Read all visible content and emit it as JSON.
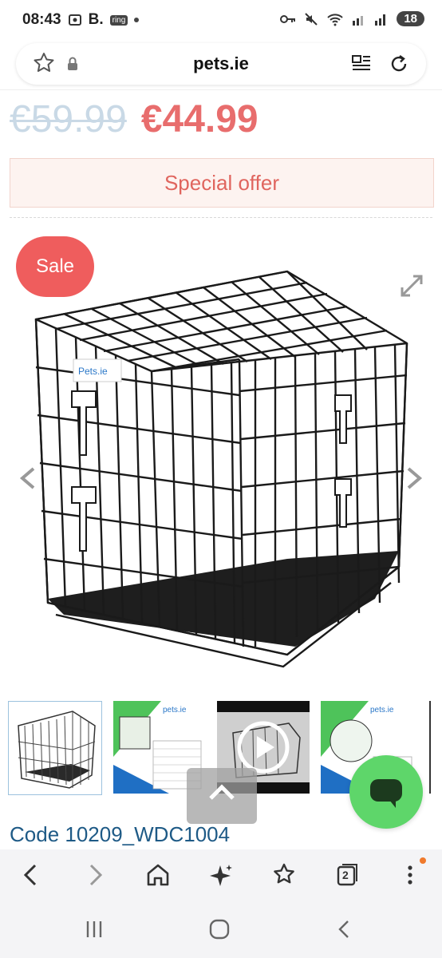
{
  "status_bar": {
    "time": "08:43",
    "carrier_letter": "B.",
    "app_badge": "ring",
    "battery": "18"
  },
  "browser": {
    "url": "pets.ie",
    "tabs_count": "2"
  },
  "product": {
    "old_price": "€59.99",
    "new_price": "€44.99",
    "offer_label": "Special offer",
    "sale_badge": "Sale",
    "box_brand": "Pets.ie",
    "code": "Code 10209_WDC1004"
  },
  "thumbnails": {
    "brand_label": "pets.ie"
  },
  "colors": {
    "sale_red": "#ef5d5d",
    "price_red": "#e86d6d",
    "chat_green": "#5ed66a",
    "code_blue": "#1e5a86"
  },
  "icons": [
    "star-outline-icon",
    "lock-icon",
    "reader-mode-icon",
    "reload-icon",
    "expand-icon",
    "chevron-left-icon",
    "chevron-right-icon",
    "play-icon",
    "chevron-up-icon",
    "chat-icon",
    "back-icon",
    "forward-icon",
    "home-icon",
    "sparkle-icon",
    "bookmark-star-icon",
    "tabs-icon",
    "more-icon",
    "recent-apps-icon",
    "home-circle-icon",
    "nav-back-icon"
  ]
}
